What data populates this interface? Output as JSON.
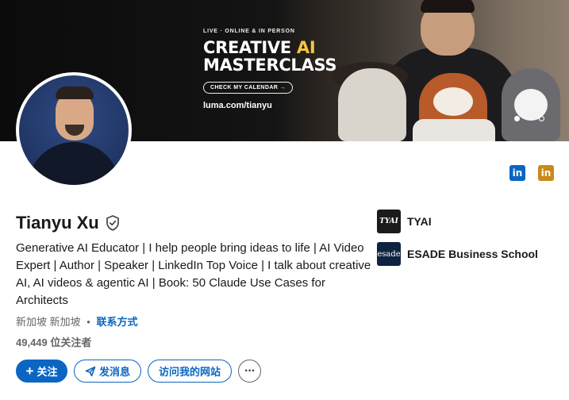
{
  "banner": {
    "eyebrow": "LIVE · ONLINE & IN PERSON",
    "headline_part1": "CREATIVE ",
    "headline_accent": "AI",
    "headline_part2": "MASTERCLASS",
    "cta": "CHECK MY CALENDAR →",
    "url": "luma.com/tianyu",
    "carousel_active_index": 0,
    "carousel_count": 2
  },
  "social_icons": [
    {
      "icon": "linkedin-icon",
      "label": "in",
      "color": "#0a66c2"
    },
    {
      "icon": "linkedin-icon",
      "label": "in",
      "color": "#c9891a"
    }
  ],
  "profile": {
    "name": "Tianyu Xu",
    "verified_icon": "verified-shield-icon",
    "headline": "Generative AI Educator | I help people bring ideas to life | AI Video Expert | Author | Speaker | LinkedIn Top Voice | I talk about creative AI, AI videos & agentic AI | Book: 50 Claude Use Cases for Architects",
    "location": "新加坡 新加坡",
    "location_sep": "•",
    "contact_link": "联系方式",
    "followers": "49,449 位关注者"
  },
  "companies": [
    {
      "logo_text": "TYAI",
      "name": "TYAI"
    },
    {
      "logo_text": "esade",
      "name": "ESADE Business School"
    }
  ],
  "actions": {
    "follow": "关注",
    "message": "发消息",
    "website": "访问我的网站",
    "more": "···"
  },
  "colors": {
    "primary": "#0a66c2",
    "accent_gold": "#f5c542",
    "text": "#191919",
    "muted": "#666666"
  }
}
